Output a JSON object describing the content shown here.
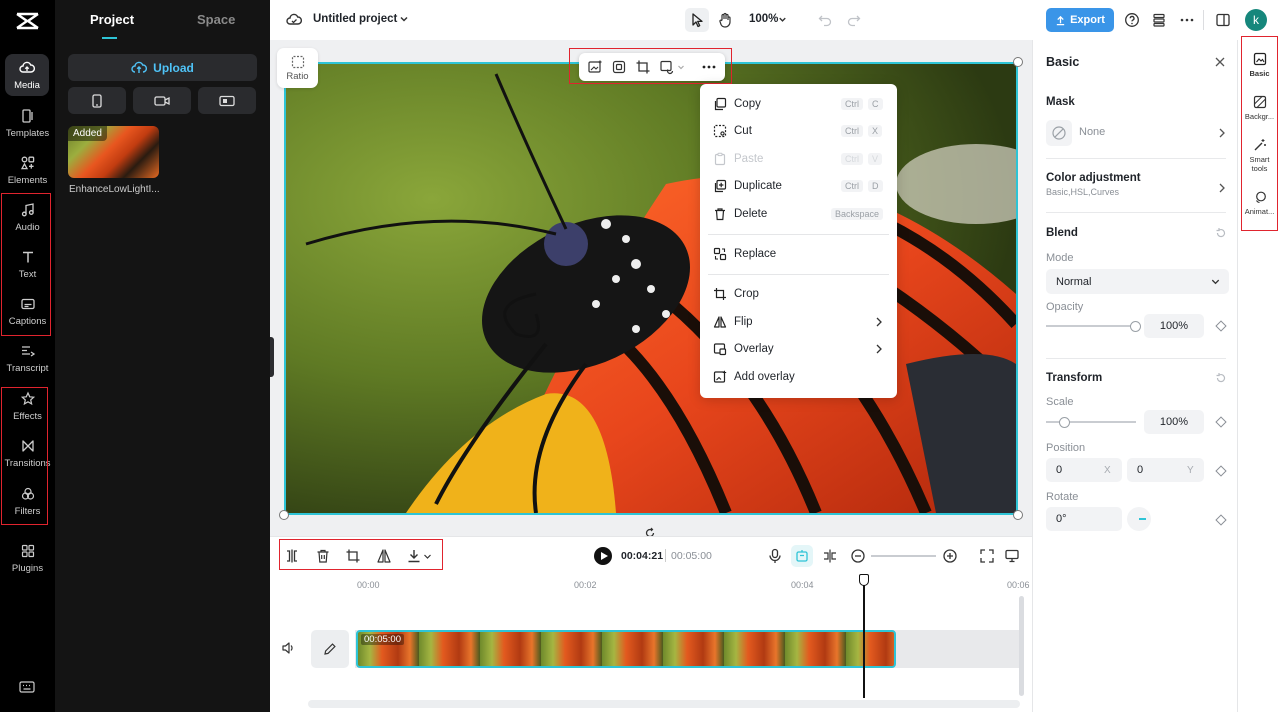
{
  "rail": {
    "items": [
      {
        "label": "Media",
        "icon": "media-cloud-icon"
      },
      {
        "label": "Templates",
        "icon": "templates-icon"
      },
      {
        "label": "Elements",
        "icon": "elements-icon"
      },
      {
        "label": "Audio",
        "icon": "audio-note-icon"
      },
      {
        "label": "Text",
        "icon": "text-t-icon"
      },
      {
        "label": "Captions",
        "icon": "captions-icon"
      },
      {
        "label": "Transcript",
        "icon": "transcript-icon"
      },
      {
        "label": "Effects",
        "icon": "effects-star-icon"
      },
      {
        "label": "Transitions",
        "icon": "transitions-bowtie-icon"
      },
      {
        "label": "Filters",
        "icon": "filters-icon"
      },
      {
        "label": "Plugins",
        "icon": "plugins-grid-icon"
      }
    ]
  },
  "panel": {
    "tab_project": "Project",
    "tab_space": "Space",
    "upload_label": "Upload",
    "media_item": {
      "tag": "Added",
      "name": "EnhanceLowLightI..."
    }
  },
  "topbar": {
    "project_title": "Untitled project",
    "zoom": "100%",
    "export_label": "Export",
    "avatar_letter": "k"
  },
  "canvas": {
    "ratio_label": "Ratio"
  },
  "context_menu": {
    "items": [
      {
        "label": "Copy",
        "shortcut": [
          "Ctrl",
          "C"
        ]
      },
      {
        "label": "Cut",
        "shortcut": [
          "Ctrl",
          "X"
        ]
      },
      {
        "label": "Paste",
        "shortcut": [
          "Ctrl",
          "V"
        ],
        "disabled": true
      },
      {
        "label": "Duplicate",
        "shortcut": [
          "Ctrl",
          "D"
        ]
      },
      {
        "label": "Delete",
        "shortcut": [
          "Backspace"
        ]
      },
      {
        "label": "Replace"
      },
      {
        "label": "Crop"
      },
      {
        "label": "Flip"
      },
      {
        "label": "Overlay"
      },
      {
        "label": "Add overlay"
      }
    ]
  },
  "right_panel": {
    "title": "Basic",
    "mask_heading": "Mask",
    "mask_value": "None",
    "color_adj_heading": "Color adjustment",
    "color_adj_sub": "Basic,HSL,Curves",
    "blend_heading": "Blend",
    "mode_label": "Mode",
    "mode_value": "Normal",
    "opacity_label": "Opacity",
    "opacity_value": "100%",
    "opacity_level": 1.0,
    "transform_heading": "Transform",
    "scale_label": "Scale",
    "scale_value": "100%",
    "position_label": "Position",
    "pos_x": "0",
    "pos_x_axis": "X",
    "pos_y": "0",
    "pos_y_axis": "Y",
    "rotate_label": "Rotate",
    "rotate_value": "0°"
  },
  "right_tools": [
    {
      "label": "Basic",
      "icon": "basic-image-icon"
    },
    {
      "label": "Backgr...",
      "icon": "background-icon"
    },
    {
      "label": "Smart tools",
      "icon": "magic-wand-icon"
    },
    {
      "label": "Animat...",
      "icon": "animation-icon"
    }
  ],
  "playback": {
    "current_time": "00:04:21",
    "total_time": "00:05:00"
  },
  "timeline": {
    "ticks": [
      "00:00",
      "00:02",
      "00:04",
      "00:06"
    ],
    "clip_duration": "00:05:00"
  },
  "colors": {
    "accent": "#2ec4d6",
    "export": "#3a95e8",
    "highlight_box": "#e0242e"
  }
}
